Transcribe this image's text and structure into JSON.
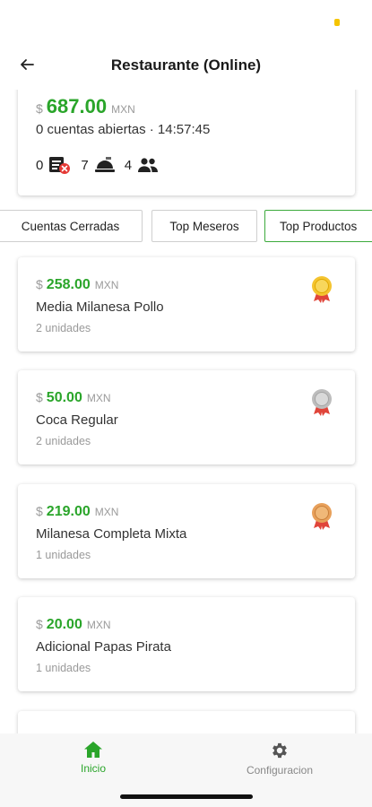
{
  "header": {
    "title": "Restaurante (Online)"
  },
  "summary": {
    "currency_symbol": "$",
    "amount": "687.00",
    "unit": "MXN",
    "subtitle": "0 cuentas abiertas · 14:57:45",
    "stats": [
      {
        "value": "0",
        "icon": "closed-bill-icon"
      },
      {
        "value": "7",
        "icon": "serving-dish-icon"
      },
      {
        "value": "4",
        "icon": "people-icon"
      }
    ]
  },
  "tabs": [
    {
      "label": "Cuentas Cerradas",
      "active": false
    },
    {
      "label": "Top Meseros",
      "active": false
    },
    {
      "label": "Top Productos",
      "active": true
    }
  ],
  "products": [
    {
      "currency_symbol": "$",
      "amount": "258.00",
      "unit": "MXN",
      "name": "Media Milanesa Pollo",
      "qty": "2 unidades",
      "medal": "gold-medal-icon"
    },
    {
      "currency_symbol": "$",
      "amount": "50.00",
      "unit": "MXN",
      "name": "Coca Regular",
      "qty": "2 unidades",
      "medal": "silver-medal-icon"
    },
    {
      "currency_symbol": "$",
      "amount": "219.00",
      "unit": "MXN",
      "name": "Milanesa Completa Mixta",
      "qty": "1 unidades",
      "medal": "bronze-medal-icon"
    },
    {
      "currency_symbol": "$",
      "amount": "20.00",
      "unit": "MXN",
      "name": "Adicional Papas Pirata",
      "qty": "1 unidades",
      "medal": ""
    }
  ],
  "nav": {
    "home_label": "Inicio",
    "settings_label": "Configuracion",
    "active": "home"
  },
  "colors": {
    "accent": "#2aa52a",
    "muted": "#9a9a9a",
    "gold": "#f4c430",
    "silver": "#c7c7c7",
    "bronze": "#e8a05a",
    "ribbon": "#e0453a"
  }
}
